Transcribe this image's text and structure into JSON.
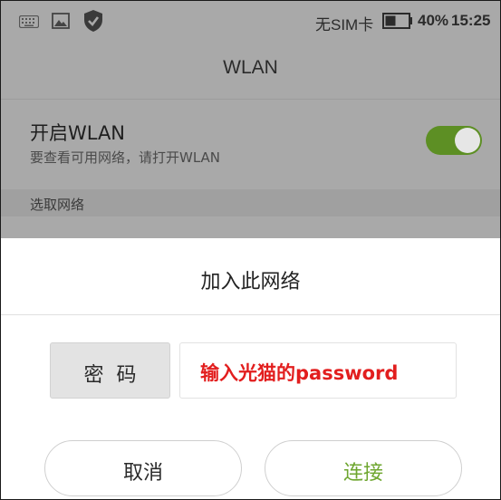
{
  "status_bar": {
    "sim": "无SIM卡",
    "battery": "40%",
    "time": "15:25",
    "icons": [
      "keyboard-icon",
      "image-icon",
      "shield-check-icon",
      "battery-icon"
    ]
  },
  "header": {
    "title": "WLAN"
  },
  "wlan_toggle": {
    "title": "开启WLAN",
    "subtitle": "要查看可用网络，请打开WLAN",
    "state": "on",
    "accent": "#5d8f24"
  },
  "section": {
    "label": "选取网络"
  },
  "dialog": {
    "title": "加入此网络",
    "password_label": "密码",
    "password_value": "输入光猫的password",
    "password_value_color": "#e21e1e",
    "cancel_label": "取消",
    "connect_label": "连接",
    "connect_color": "#6ea62f"
  }
}
